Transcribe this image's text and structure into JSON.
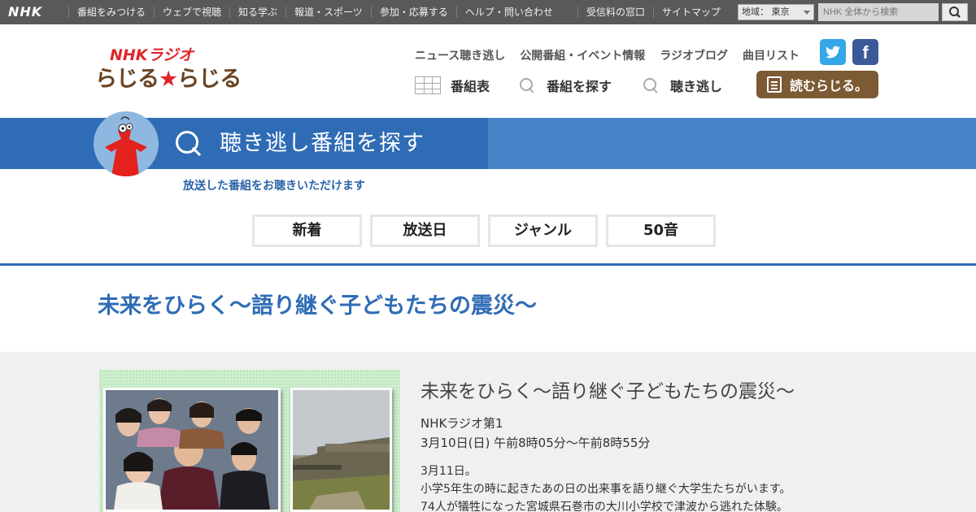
{
  "global_bar": {
    "logo": "NHK",
    "links": [
      "番組をみつける",
      "ウェブで視聴",
      "知る学ぶ",
      "報道・スポーツ",
      "参加・応募する",
      "ヘルプ・問い合わせ"
    ],
    "right_links": [
      "受信料の窓口",
      "サイトマップ"
    ],
    "region": "地域： 東京",
    "search_placeholder": "NHK 全体から検索"
  },
  "brand": {
    "top": "NHKラジオ",
    "bottom_left": "らじる",
    "bottom_star": "★",
    "bottom_right": "らじる"
  },
  "top_nav": [
    "ニュース聴き逃し",
    "公開番組・イベント情報",
    "ラジオブログ",
    "曲目リスト"
  ],
  "sns": {
    "facebook_glyph": "f"
  },
  "main_nav": {
    "schedule": "番組表",
    "find": "番組を探す",
    "catchup": "聴き逃し",
    "read_button": "読むらじる。"
  },
  "band": {
    "title": "聴き逃し番組を探す",
    "caption": "放送した番組をお聴きいただけます"
  },
  "tabs": [
    "新着",
    "放送日",
    "ジャンル",
    "50音"
  ],
  "program": {
    "heading": "未来をひらく～語り継ぐ子どもたちの震災～"
  },
  "episode": {
    "title": "未来をひらく～語り継ぐ子どもたちの震災～",
    "channel": "NHKラジオ第1",
    "datetime": "3月10日(日) 午前8時05分〜午前8時55分",
    "desc": [
      "3月11日。",
      "小学5年生の時に起きたあの日の出来事を語り継ぐ大学生たちがいます。",
      "74人が犠牲になった宮城県石巻市の大川小学校で津波から逃れた体験。"
    ]
  },
  "colors": {
    "brand_blue": "#2f6cb5",
    "band_blue": "#4a84c8",
    "brand_red": "#e0262a",
    "brand_brown": "#6b4423",
    "button_brown": "#7b5a34",
    "twitter": "#35a6e8",
    "facebook": "#3b5a9a"
  }
}
